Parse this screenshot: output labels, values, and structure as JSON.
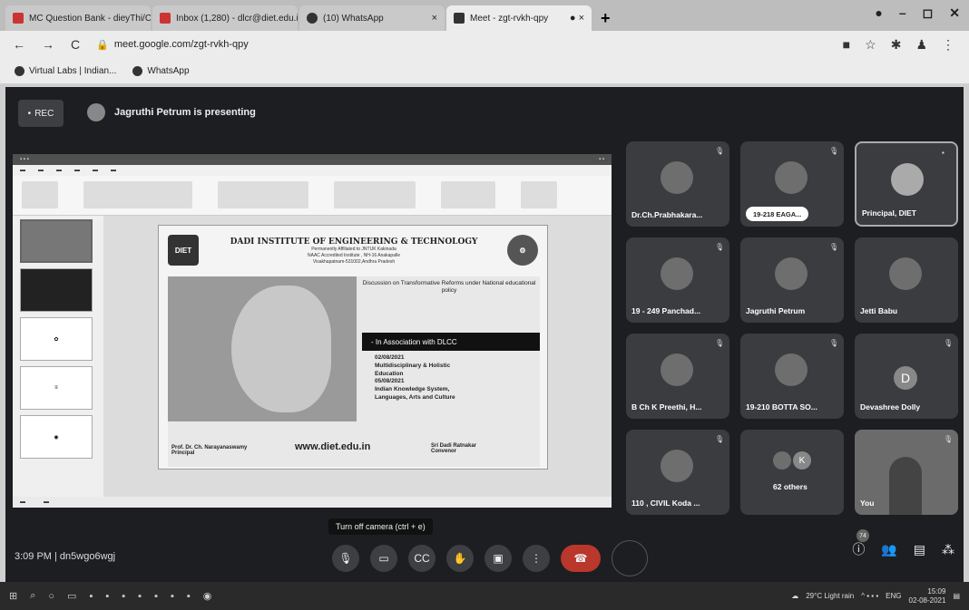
{
  "browser": {
    "tabs": [
      {
        "label": "MC Question Bank - dieyThi/Cr",
        "active": false
      },
      {
        "label": "Inbox (1,280) - dlcr@diet.edu.in",
        "active": false
      },
      {
        "label": "(10) WhatsApp",
        "active": false
      },
      {
        "label": "Meet - zgt-rvkh-qpy",
        "active": true
      }
    ],
    "url": "meet.google.com/zgt-rvkh-qpy",
    "bookmarks": [
      "Virtual Labs | Indian...",
      "WhatsApp"
    ]
  },
  "meet": {
    "rec_label": "REC",
    "presenting_text": "Jagruthi Petrum is presenting",
    "tooltip": "Turn off camera (ctrl + e)",
    "time_code": "3:09 PM  |  dn5wgo6wgj",
    "participant_badge": "74",
    "tiles": [
      {
        "name": "Dr.Ch.Prabhakara..."
      },
      {
        "name": "19-218 EAGA..."
      },
      {
        "name": "Principal, DIET"
      },
      {
        "name": "19 - 249 Panchad..."
      },
      {
        "name": "Jagruthi Petrum"
      },
      {
        "name": "Jetti Babu"
      },
      {
        "name": "B Ch K Preethi, H..."
      },
      {
        "name": "19-210 BOTTA SO..."
      },
      {
        "name": "Devashree Dolly",
        "letter": "D"
      },
      {
        "name": "110 , CIVIL Koda ..."
      },
      {
        "name": "62 others",
        "letter": "K"
      },
      {
        "name": "You"
      }
    ]
  },
  "slide": {
    "institute": "DADI INSTITUTE OF ENGINEERING & TECHNOLOGY",
    "sub1": "Permanently Affiliated to JNTUK Kakinada",
    "sub2": "NAAC Accredited Institute , NH-16 Anakapalle",
    "sub3": "Visakhapatnam-531002,Andhra Pradesh",
    "discussion": "Discussion on Transformative Reforms under National educational policy",
    "association": "- In Association with DLCC",
    "items": [
      "02/08/2021",
      "Multidisciplinary & Holistic",
      "Education",
      "05/08/2021",
      "Indian Knowledge System,",
      "Languages, Arts and Culture"
    ],
    "footer_left": "Prof. Dr. Ch. Narayanaswamy",
    "footer_role": "Principal",
    "website": "www.diet.edu.in",
    "convenor": "Sri Dadi Ratnakar",
    "convenor_role": "Convenor",
    "logo_text": "DIET"
  },
  "taskbar": {
    "weather": "29°C  Light rain",
    "lang": "ENG",
    "time": "15:09",
    "date": "02-08-2021"
  }
}
